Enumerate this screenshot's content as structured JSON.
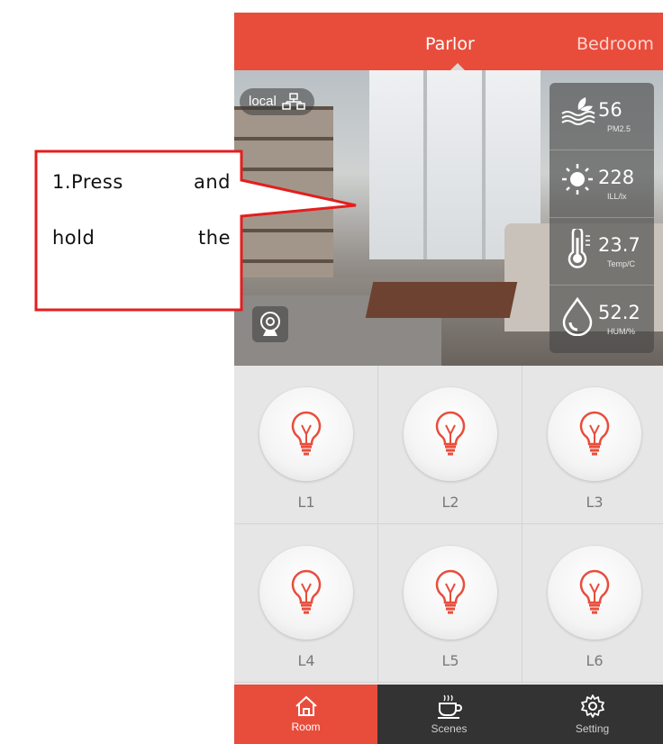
{
  "tabs": [
    {
      "label": "Parlor",
      "active": true
    },
    {
      "label": "Bedroom",
      "active": false
    }
  ],
  "hero": {
    "mode_label": "local",
    "sensors": [
      {
        "icon": "pm25-icon",
        "value": "56",
        "unit": "PM2.5"
      },
      {
        "icon": "sun-icon",
        "value": "228",
        "unit": "ILL/lx"
      },
      {
        "icon": "thermometer-icon",
        "value": "23.7",
        "unit": "Temp/C"
      },
      {
        "icon": "humidity-icon",
        "value": "52.2",
        "unit": "HUM/%"
      }
    ]
  },
  "lights": [
    {
      "label": "L1"
    },
    {
      "label": "L2"
    },
    {
      "label": "L3"
    },
    {
      "label": "L4"
    },
    {
      "label": "L5"
    },
    {
      "label": "L6"
    }
  ],
  "bottom_nav": [
    {
      "label": "Room",
      "icon": "home-icon",
      "active": true
    },
    {
      "label": "Scenes",
      "icon": "coffee-cup-icon",
      "active": false
    },
    {
      "label": "Setting",
      "icon": "gear-icon",
      "active": false
    }
  ],
  "callout": {
    "line1_word1": "1.Press",
    "line1_word2": "and",
    "line2_word1": "hold",
    "line2_word2": "the"
  },
  "colors": {
    "accent": "#e84d3c",
    "nav_dark": "#333333",
    "callout_border": "#e41e1e"
  }
}
